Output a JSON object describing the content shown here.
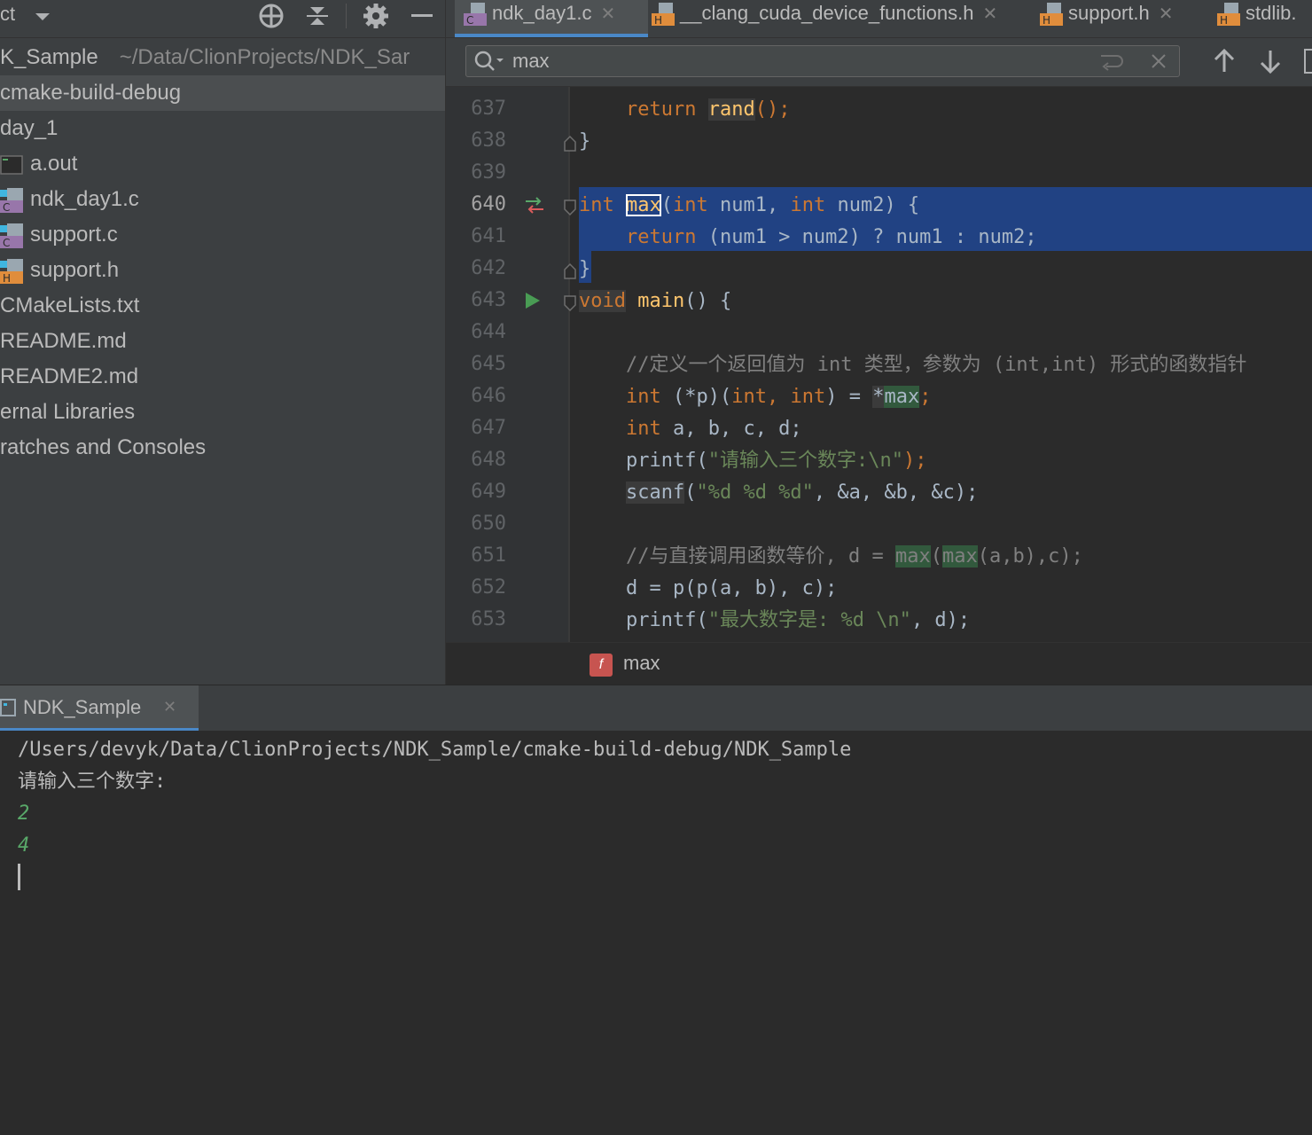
{
  "project_panel": {
    "title": "ct",
    "toolbar_icons": [
      "chevron-down-icon",
      "locate-icon",
      "collapse-icon",
      "gear-icon",
      "minimize-icon"
    ],
    "tree": [
      {
        "label": "K_Sample",
        "path": "~/Data/ClionProjects/NDK_Sar",
        "icon": "",
        "selected": false
      },
      {
        "label": "cmake-build-debug",
        "icon": "",
        "selected": true
      },
      {
        "label": "day_1",
        "icon": "",
        "selected": false
      },
      {
        "label": "a.out",
        "icon": "executable-icon",
        "selected": false
      },
      {
        "label": "ndk_day1.c",
        "icon": "c-file-icon",
        "selected": false
      },
      {
        "label": "support.c",
        "icon": "c-file-icon",
        "selected": false
      },
      {
        "label": "support.h",
        "icon": "h-file-icon",
        "selected": false
      },
      {
        "label": "CMakeLists.txt",
        "icon": "",
        "selected": false
      },
      {
        "label": "README.md",
        "icon": "",
        "selected": false
      },
      {
        "label": "README2.md",
        "icon": "",
        "selected": false
      },
      {
        "label": "ernal Libraries",
        "icon": "",
        "selected": false
      },
      {
        "label": "ratches and Consoles",
        "icon": "",
        "selected": false
      }
    ]
  },
  "editor": {
    "tabs": [
      {
        "label": "ndk_day1.c",
        "icon": "c-file-icon",
        "active": true,
        "closable": true
      },
      {
        "label": "__clang_cuda_device_functions.h",
        "icon": "h-file-icon",
        "active": false,
        "closable": true
      },
      {
        "label": "support.h",
        "icon": "h-file-icon",
        "active": false,
        "closable": true
      },
      {
        "label": "stdlib.",
        "icon": "h-file-icon",
        "active": false,
        "closable": false
      }
    ],
    "search": {
      "value": "max",
      "icons": [
        "search-icon",
        "wrap-icon",
        "clear-icon",
        "previous-occurrence-icon",
        "next-occurrence-icon"
      ]
    },
    "line_numbers": [
      "637",
      "638",
      "639",
      "640",
      "641",
      "642",
      "643",
      "644",
      "645",
      "646",
      "647",
      "648",
      "649",
      "650",
      "651",
      "652",
      "653"
    ],
    "current_line": "640",
    "code": {
      "l637": {
        "kw": "return",
        "fn": "rand",
        "rest": "();"
      },
      "l638": "}",
      "l640": {
        "type": "int",
        "name": "max",
        "params_a": "(",
        "t1": "int",
        "p1": " num1, ",
        "t2": "int",
        "p2": " num2) {"
      },
      "l641": {
        "kw": "return",
        "rest": " (num1 > num2) ? num1 : num2;"
      },
      "l642": "}",
      "l643": {
        "kw": "void",
        "fn": "main",
        "rest": "() {"
      },
      "l645": "//定义一个返回值为 int 类型，参数为 (int,int) 形式的函数指针",
      "l646": {
        "t1": "int",
        "a": " (*p)(",
        "t2": "int",
        "b": ", ",
        "t3": "int",
        "c": ") = ",
        "star": "*",
        "match": "max",
        "end": ";"
      },
      "l647": {
        "kw": "int",
        "rest": " a, b, c, d;"
      },
      "l648": {
        "fn": "printf",
        "a": "(",
        "str": "\"请输入三个数字:\\n\"",
        "b": ");"
      },
      "l649": {
        "fn": "scanf",
        "a": "(",
        "str": "\"%d %d %d\"",
        "b": ", &a, &b, &c);"
      },
      "l651": {
        "a": "//与直接调用函数等价, d = ",
        "m1": "max",
        "b": "(",
        "m2": "max",
        "c": "(a,b),c);"
      },
      "l652": "d = p(p(a, b), c);",
      "l653": {
        "fn": "printf",
        "a": "(",
        "str": "\"最大数字是: %d \\n\"",
        "b": ", d);"
      }
    },
    "gutter_icons": {
      "l640": "implementation-arrows-icon",
      "l643": "run-icon"
    },
    "breadcrumb": {
      "icon_letter": "f",
      "label": "max"
    }
  },
  "run_panel": {
    "tab_label": "NDK_Sample",
    "lines": [
      {
        "text": "/Users/devyk/Data/ClionProjects/NDK_Sample/cmake-build-debug/NDK_Sample",
        "kind": "output"
      },
      {
        "text": "请输入三个数字:",
        "kind": "output"
      },
      {
        "text": "2",
        "kind": "input"
      },
      {
        "text": "4",
        "kind": "input"
      }
    ]
  },
  "colors": {
    "panel_bg": "#3c3f41",
    "editor_bg": "#2b2b2b",
    "selection": "#214283",
    "keyword": "#cc7832",
    "function": "#ffc66d",
    "string": "#6a8759",
    "accent": "#4a88c7"
  }
}
